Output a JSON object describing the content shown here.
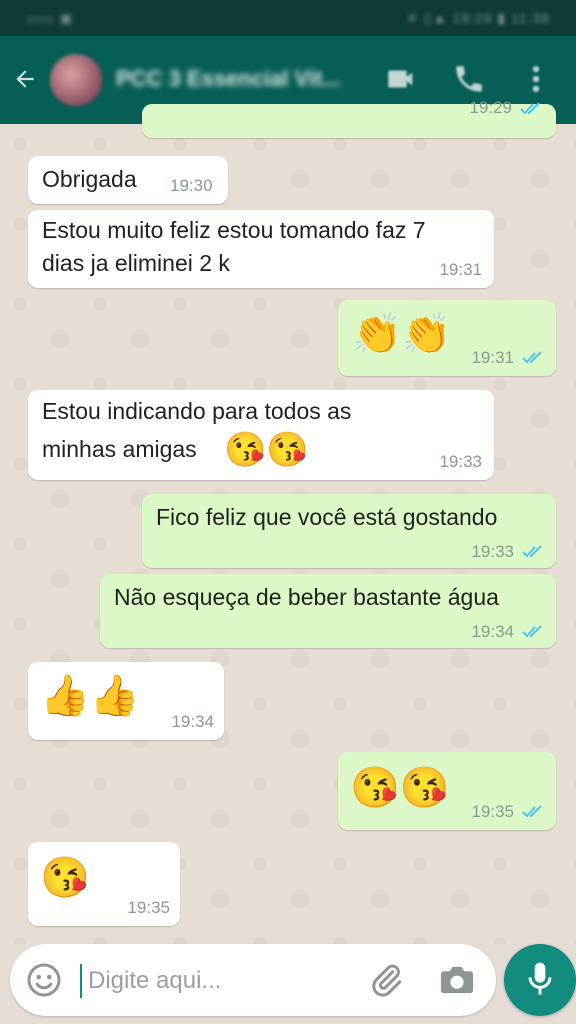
{
  "status_bar": {
    "left": "▭▭ ▣",
    "right": "✕ ▯▲ 19:29 ▮ 11:38"
  },
  "header": {
    "contact_name": "PCC 3 Essencial Vit..."
  },
  "colors": {
    "header": "#075e54",
    "incoming": "#ffffff",
    "outgoing": "#dcf8c6",
    "tick_read": "#4fc3f7",
    "accent": "#128c7e"
  },
  "messages": [
    {
      "direction": "out",
      "text": "",
      "time": "19:29"
    },
    {
      "direction": "in",
      "text": "Obrigada",
      "time": "19:30"
    },
    {
      "direction": "in",
      "line1": "Estou muito feliz estou tomando faz 7",
      "line2": "dias ja eliminei 2 k",
      "time": "19:31"
    },
    {
      "direction": "out",
      "emoji": "👏👏",
      "time": "19:31"
    },
    {
      "direction": "in",
      "line1": "Estou indicando para todos as",
      "line2_text": "minhas amigas",
      "line2_emoji": "😘😘",
      "time": "19:33"
    },
    {
      "direction": "out",
      "text": "Fico feliz que você está gostando",
      "time": "19:33"
    },
    {
      "direction": "out",
      "text": "Não esqueça de beber bastante água",
      "time": "19:34"
    },
    {
      "direction": "in",
      "emoji": "👍👍",
      "time": "19:34"
    },
    {
      "direction": "out",
      "emoji": "😘😘",
      "time": "19:35"
    },
    {
      "direction": "in",
      "emoji": "😘",
      "time": "19:35"
    }
  ],
  "input": {
    "placeholder": "Digite aqui..."
  },
  "icons": {
    "back": "back-arrow-icon",
    "video": "video-call-icon",
    "call": "phone-icon",
    "menu": "more-vert-icon",
    "emoji": "smiley-icon",
    "attach": "paperclip-icon",
    "camera": "camera-icon",
    "mic": "microphone-icon",
    "ticks": "double-check-icon"
  }
}
